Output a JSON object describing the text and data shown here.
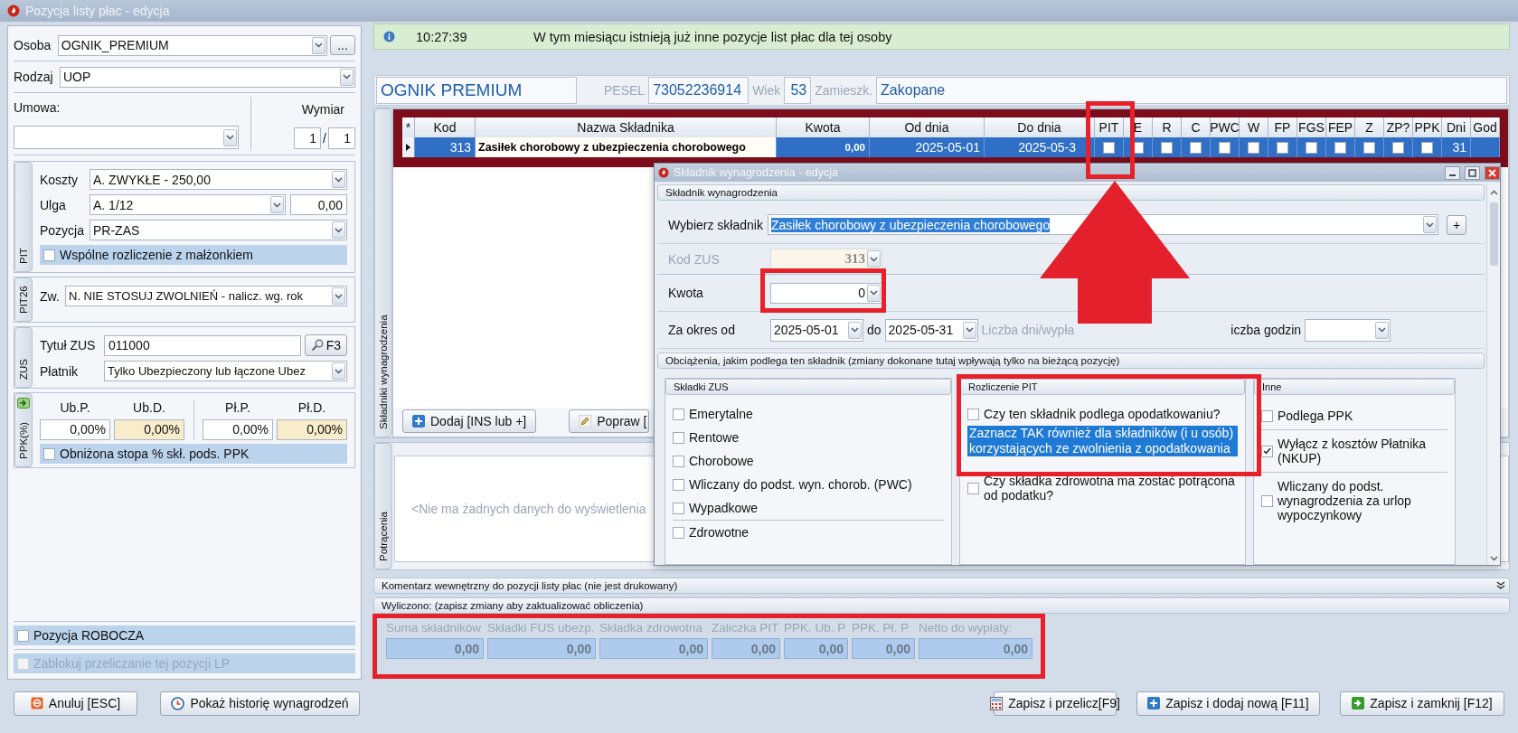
{
  "window": {
    "title": "Pozycja listy płac - edycja"
  },
  "left_panel": {
    "osoba": {
      "label": "Osoba",
      "value": "OGNIK_PREMIUM",
      "button": "..."
    },
    "rodzaj": {
      "label": "Rodzaj",
      "value": "UOP"
    },
    "umowa": {
      "label": "Umowa:"
    },
    "wymiar": {
      "label": "Wymiar",
      "numerator": "1",
      "separator": "/",
      "denominator": "1"
    },
    "pit": {
      "tab": "PIT",
      "koszty": {
        "label": "Koszty",
        "value": "A. ZWYKŁE - 250,00"
      },
      "ulga": {
        "label": "Ulga",
        "value": "A. 1/12",
        "amount": "0,00"
      },
      "pozycja": {
        "label": "Pozycja",
        "value": "PR-ZAS"
      },
      "joint": {
        "label": "Wspólne rozliczenie z małżonkiem",
        "checked": false
      }
    },
    "pit26": {
      "tab": "PIT26",
      "label": "Zw.",
      "value": "N. NIE STOSUJ ZWOLNIEŃ - nalicz. wg. rok"
    },
    "zus": {
      "tab": "ZUS",
      "tytul": {
        "label": "Tytuł ZUS",
        "value": "011000",
        "button": "F3"
      },
      "platnik": {
        "label": "Płatnik",
        "value": "Tylko Ubezpieczony lub łączone Ubez"
      }
    },
    "ppk": {
      "tab": "PPK(%)",
      "rates": [
        {
          "label": "Ub.P.",
          "value": "0,00%",
          "readonly": false
        },
        {
          "label": "Ub.D.",
          "value": "0,00%",
          "readonly": true
        },
        {
          "label": "Pł.P.",
          "value": "0,00%",
          "readonly": false
        },
        {
          "label": "Pł.D.",
          "value": "0,00%",
          "readonly": true
        }
      ],
      "reduced": {
        "label": "Obniżona stopa % skł. pods. PPK",
        "checked": false
      }
    },
    "options": [
      {
        "label": "Pozycja ROBOCZA",
        "checked": false,
        "disabled": false
      },
      {
        "label": "Zablokuj przeliczanie tej pozycji LP",
        "checked": false,
        "disabled": true
      }
    ],
    "buttons": [
      {
        "label": "Anuluj [ESC]",
        "kind": "cancel"
      },
      {
        "label": "Pokaż historię wynagrodzeń",
        "kind": "history"
      }
    ]
  },
  "info": {
    "time": "10:27:39",
    "message": "W tym miesiącu istnieją już inne pozycje list płac dla tej osoby"
  },
  "person": {
    "name": "OGNIK PREMIUM",
    "pesel_label": "PESEL",
    "pesel": "73052236914",
    "age_label": "Wiek",
    "age": "53",
    "city_label": "Zamieszk.",
    "city": "Zakopane"
  },
  "components": {
    "tab": "Składniki wynagrodzenia",
    "table": {
      "columns": [
        "*",
        "Kod",
        "Nazwa Składnika",
        "Kwota",
        "Od dnia",
        "Do dnia",
        "PIT",
        "E",
        "R",
        "C",
        "PWC",
        "W",
        "FP",
        "FGS",
        "FEP",
        "Z",
        "ZP?",
        "PPK",
        "Dni",
        "God"
      ],
      "rows": [
        {
          "selected": true,
          "cells": [
            {
              "kind": "marker"
            },
            {
              "kind": "text",
              "text": "313"
            },
            {
              "kind": "edit",
              "text": "Zasiłek chorobowy z ubezpieczenia chorobowego"
            },
            {
              "kind": "text",
              "text": "0,00"
            },
            {
              "kind": "text",
              "text": "2025-05-01"
            },
            {
              "kind": "text",
              "text": "2025-05-3"
            },
            {
              "kind": "check",
              "checked": false
            },
            {
              "kind": "check",
              "checked": false
            },
            {
              "kind": "check",
              "checked": false
            },
            {
              "kind": "check",
              "checked": false
            },
            {
              "kind": "check",
              "checked": false
            },
            {
              "kind": "check",
              "checked": false
            },
            {
              "kind": "check",
              "checked": false
            },
            {
              "kind": "check",
              "checked": false
            },
            {
              "kind": "check",
              "checked": false
            },
            {
              "kind": "check",
              "checked": false
            },
            {
              "kind": "check",
              "checked": false
            },
            {
              "kind": "check",
              "checked": false
            },
            {
              "kind": "text",
              "text": "31"
            }
          ]
        }
      ]
    },
    "buttons": [
      {
        "label": "Dodaj [INS lub +]",
        "kind": "add"
      },
      {
        "label": "Popraw [",
        "kind": "edit"
      }
    ]
  },
  "deductions": {
    "tab": "Potrącenia",
    "empty_text": "<Nie ma żadnych danych do wyświetlenia"
  },
  "comment_bar": {
    "title": "Komentarz wewnętrzny do pozycji listy płac (nie jest drukowany)"
  },
  "calculated": {
    "title": "Wyliczono: (zapisz zmiany aby zaktualizować obliczenia)",
    "totals": [
      {
        "label": "Suma składników",
        "value": "0,00"
      },
      {
        "label": "Składki FUS ubezp.",
        "value": "0,00"
      },
      {
        "label": "Składka zdrowotna",
        "value": "0,00"
      },
      {
        "label": "Zaliczka PIT",
        "value": "0,00"
      },
      {
        "label": "PPK. Ub. P",
        "value": "0,00"
      },
      {
        "label": "PPK. Pł. P",
        "value": "0,00"
      },
      {
        "label": "Netto do wypłaty:",
        "value": "0,00"
      }
    ]
  },
  "footer_buttons": [
    {
      "label": "Zapisz i przelicz[F9]",
      "kind": "calc"
    },
    {
      "label": "Zapisz i dodaj nową [F11]",
      "kind": "add"
    },
    {
      "label": "Zapisz i zamknij [F12]",
      "kind": "save"
    }
  ],
  "dialog": {
    "title": "Składnik wynagrodzenia - edycja",
    "group": "Składnik wynagrodzenia",
    "component": {
      "label": "Wybierz składnik",
      "value": "Zasiłek chorobowy z ubezpieczenia chorobowego",
      "selected": true,
      "button": "+"
    },
    "zus_code": {
      "label": "Kod ZUS",
      "value": "313",
      "disabled": true
    },
    "amount": {
      "label": "Kwota",
      "value": "0"
    },
    "period": {
      "label": "Za okres od",
      "from": "2025-05-01",
      "to_label": "do",
      "to": "2025-05-31",
      "days_label": "Liczba dni/wypła",
      "hours_label": "iczba godzin"
    },
    "charges_group": "Obciążenia, jakim podlega ten składnik (zmiany dokonane tutaj wpływają tylko na bieżącą pozycję)",
    "sections": [
      {
        "title": "Składki ZUS",
        "items": [
          {
            "kind": "check",
            "label": "Emerytalne",
            "checked": false,
            "separated": false
          },
          {
            "kind": "check",
            "label": "Rentowe",
            "checked": false,
            "separated": false
          },
          {
            "kind": "check",
            "label": "Chorobowe",
            "checked": false,
            "separated": false
          },
          {
            "kind": "check",
            "label": "Wliczany do podst. wyn. chorob. (PWC)",
            "checked": false,
            "separated": false
          },
          {
            "kind": "check",
            "label": "Wypadkowe",
            "checked": false,
            "separated": false
          },
          {
            "kind": "check",
            "label": "Zdrowotne",
            "checked": false,
            "separated": true
          }
        ]
      },
      {
        "title": "Rozliczenie PIT",
        "items": [
          {
            "kind": "check",
            "label": "Czy ten składnik podlega opodatkowaniu?",
            "checked": false,
            "separated": false
          },
          {
            "kind": "note",
            "text": "Zaznacz TAK również dla składników (i u osób) korzystających ze zwolnienia z opodatkowania",
            "separated": false
          },
          {
            "kind": "check",
            "label": "Czy składka zdrowotna ma zostać potrącona od podatku?",
            "checked": false,
            "separated": false
          }
        ]
      },
      {
        "title": "Inne",
        "items": [
          {
            "kind": "check",
            "label": "Podlega PPK",
            "checked": false,
            "separated": false
          },
          {
            "kind": "check",
            "label": "Wyłącz z kosztów Płatnika (NKUP)",
            "checked": true,
            "separated": true
          },
          {
            "kind": "check",
            "label": "Wliczany do podst. wynagrodzenia za urlop wypoczynkowy",
            "checked": false,
            "separated": true
          }
        ]
      }
    ]
  }
}
